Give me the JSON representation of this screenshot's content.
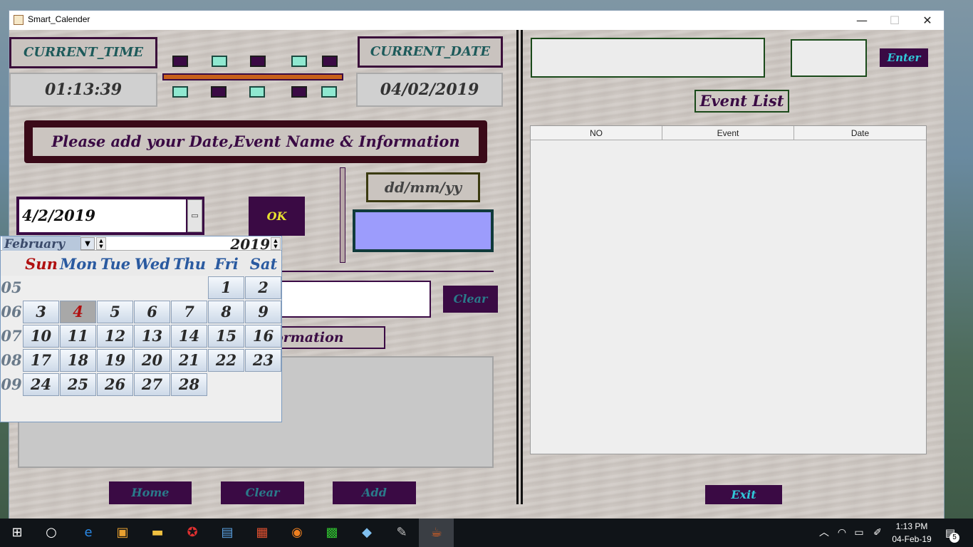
{
  "window": {
    "title": "Smart_Calender",
    "min": "—",
    "max": "☐",
    "close": "✕"
  },
  "left": {
    "current_time_label": "CURRENT_TIME",
    "current_time": "01:13:39",
    "current_date_label": "CURRENT_DATE",
    "current_date": "04/02/2019",
    "banner": "Please add your Date,Event Name  & Information",
    "date_input": "4/2/2019",
    "ok_label": "OK",
    "date_format": "dd/mm/yy",
    "clear_small": "Clear",
    "info_label_partial": "ormation",
    "home_label": "Home",
    "clear_label": "Clear",
    "add_label": "Add"
  },
  "calendar": {
    "month": "February",
    "year": "2019",
    "days": [
      "Sun",
      "Mon",
      "Tue",
      "Wed",
      "Thu",
      "Fri",
      "Sat"
    ],
    "weeks": [
      "05",
      "06",
      "07",
      "08",
      "09"
    ],
    "row1": [
      "1",
      "2"
    ],
    "row2": [
      "3",
      "4",
      "5",
      "6",
      "7",
      "8",
      "9"
    ],
    "row3": [
      "10",
      "11",
      "12",
      "13",
      "14",
      "15",
      "16"
    ],
    "row4": [
      "17",
      "18",
      "19",
      "20",
      "21",
      "22",
      "23"
    ],
    "row5": [
      "24",
      "25",
      "26",
      "27",
      "28"
    ],
    "selected_day": "4"
  },
  "right": {
    "enter_label": "Enter",
    "event_list_label": "Event List",
    "columns": [
      "NO",
      "Event",
      "Date"
    ],
    "exit_label": "Exit"
  },
  "taskbar": {
    "time": "1:13 PM",
    "date": "04-Feb-19",
    "notif_count": "5"
  },
  "colors": {
    "accent_purple": "#3a0a44",
    "teal_text": "#2a7a8a",
    "swatch": "#9c9cfc"
  }
}
